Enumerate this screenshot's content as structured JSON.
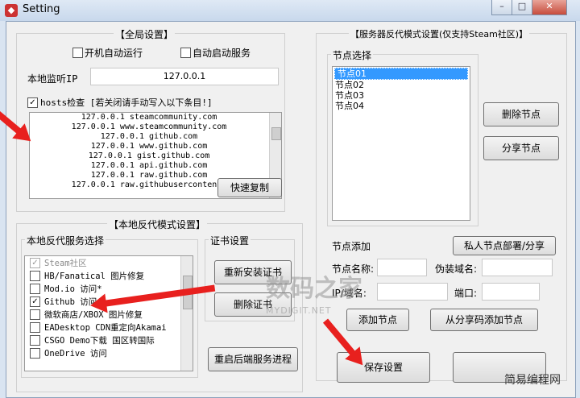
{
  "window": {
    "title": "Setting",
    "buttons": [
      "minimize",
      "maximize",
      "close"
    ]
  },
  "global": {
    "title": "【全局设置】",
    "autostart_label": "开机自动运行",
    "autostart_checked": false,
    "autoservice_label": "自动启动服务",
    "autoservice_checked": false,
    "listen_ip_label": "本地监听IP",
    "listen_ip_value": "127.0.0.1",
    "hosts_check_label": "hosts检查 [若关闭请手动写入以下条目!]",
    "hosts_check_checked": true,
    "hosts_lines": [
      "127.0.0.1 steamcommunity.com",
      "127.0.0.1 www.steamcommunity.com",
      "127.0.0.1 github.com",
      "127.0.0.1 www.github.com",
      "127.0.0.1 gist.github.com",
      "127.0.0.1 api.github.com",
      "127.0.0.1 raw.github.com",
      "127.0.0.1 raw.githubusercontent."
    ],
    "quick_copy_label": "快速复制"
  },
  "local_proxy": {
    "title": "【本地反代模式设置】",
    "services_label": "本地反代服务选择",
    "services": [
      {
        "label": "Steam社区",
        "checked": true,
        "disabled": true
      },
      {
        "label": "HB/Fanatical 图片修复",
        "checked": false
      },
      {
        "label": "Mod.io 访问*",
        "checked": false
      },
      {
        "label": "Github 访问",
        "checked": true
      },
      {
        "label": "微软商店/XBOX 图片修复",
        "checked": false
      },
      {
        "label": "EADesktop CDN重定向Akamai",
        "checked": false
      },
      {
        "label": "CSGO Demo下载 国区转国际",
        "checked": false
      },
      {
        "label": "OneDrive 访问",
        "checked": false
      }
    ],
    "cert_title": "证书设置",
    "reinstall_cert_label": "重新安装证书",
    "delete_cert_label": "删除证书",
    "restart_backend_label": "重启后端服务进程"
  },
  "server": {
    "title": "【服务器反代模式设置(仅支持Steam社区)】",
    "node_select_label": "节点选择",
    "nodes": [
      "节点01",
      "节点02",
      "节点03",
      "节点04"
    ],
    "selected_node": "节点01",
    "delete_node_label": "删除节点",
    "share_node_label": "分享节点",
    "add_section_label": "节点添加",
    "private_deploy_label": "私人节点部署/分享",
    "node_name_label": "节点名称:",
    "node_name_value": "",
    "disguise_domain_label": "伪装域名:",
    "disguise_domain_value": "",
    "ip_domain_label": "IP/域名:",
    "ip_domain_value": "",
    "port_label": "端口:",
    "port_value": "",
    "add_node_label": "添加节点",
    "add_from_share_label": "从分享码添加节点",
    "save_label": "保存设置"
  },
  "watermark": {
    "text": "数码之家",
    "sub": "MYDIGIT.NET",
    "brand": "简易编程网"
  },
  "accent": {
    "arrow": "#e8201e",
    "selection": "#3399ff"
  }
}
